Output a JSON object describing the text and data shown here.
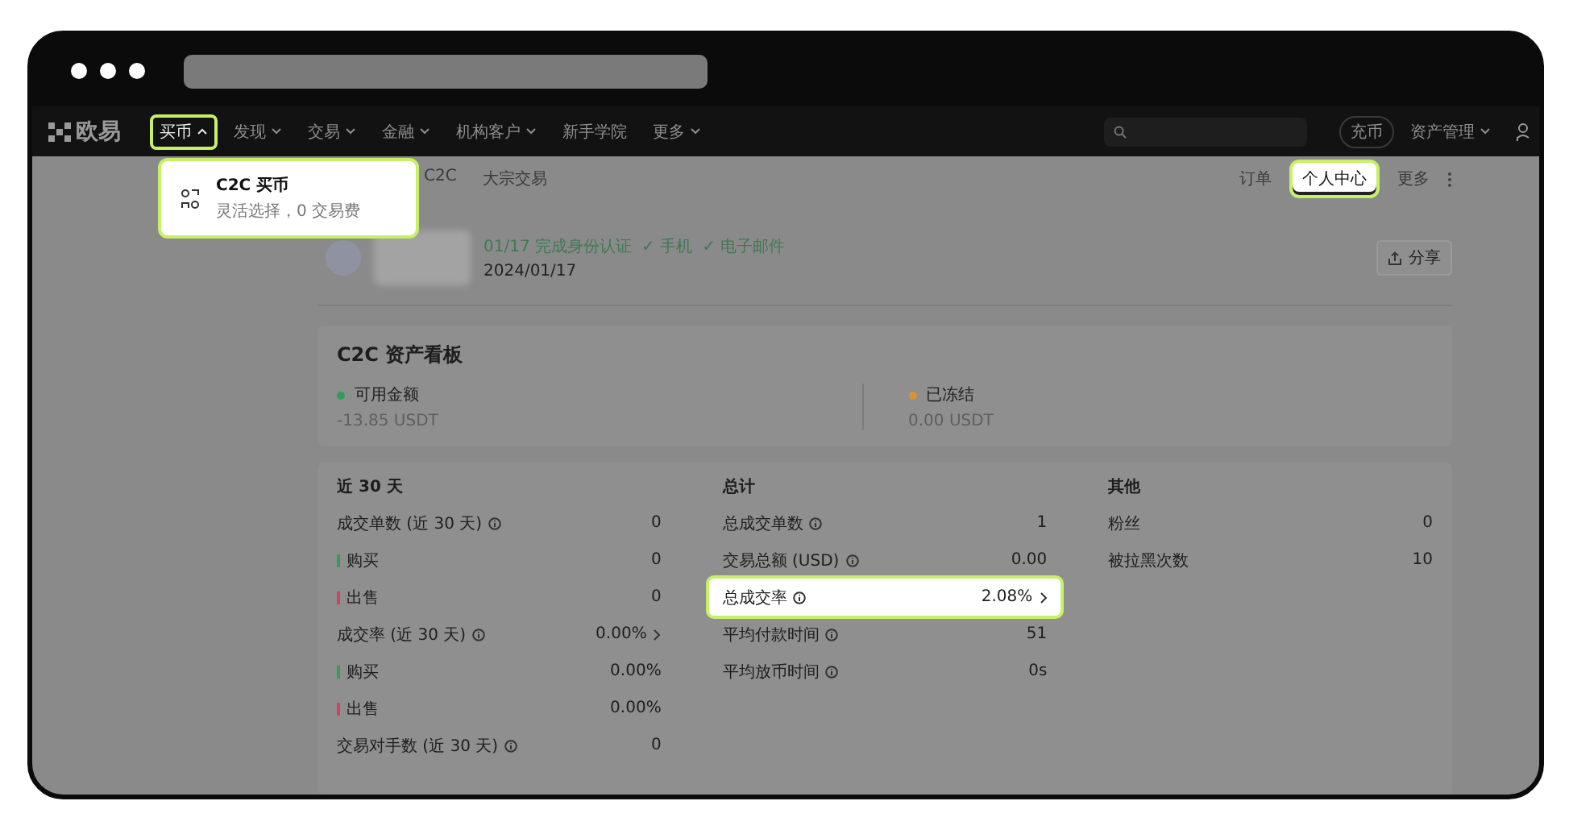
{
  "nav": {
    "logo": "欧易",
    "items": [
      {
        "label": "买币",
        "dropdown": true,
        "highlighted": true
      },
      {
        "label": "发现",
        "dropdown": true,
        "highlighted": false
      },
      {
        "label": "交易",
        "dropdown": true,
        "highlighted": false
      },
      {
        "label": "金融",
        "dropdown": true,
        "highlighted": false
      },
      {
        "label": "机构客户",
        "dropdown": true,
        "highlighted": false
      },
      {
        "label": "新手学院",
        "dropdown": false,
        "highlighted": false
      },
      {
        "label": "更多",
        "dropdown": true,
        "highlighted": false
      }
    ],
    "deposit_button": "充币",
    "asset_menu": "资产管理"
  },
  "dropdown_menu": {
    "items": [
      {
        "title": "C2C 买币",
        "subtitle": "灵活选择，0 交易费"
      }
    ]
  },
  "subnav": {
    "items": [
      "C2C",
      "大宗交易"
    ],
    "tabs": [
      {
        "label": "订单",
        "selected": false,
        "highlighted": false
      },
      {
        "label": "个人中心",
        "selected": true,
        "highlighted": true
      }
    ],
    "more": "更多"
  },
  "profile": {
    "verification": "01/17 完成身份认证",
    "checks": [
      "✓ 手机",
      "✓ 电子邮件"
    ],
    "date": "2024/01/17",
    "share": "分享"
  },
  "assets": {
    "title": "C2C 资产看板",
    "items": [
      {
        "label": "可用金额",
        "value": "-13.85 USDT",
        "color": "#2e9e5b"
      },
      {
        "label": "已冻结",
        "value": "0.00 USDT",
        "color": "#d9952b"
      }
    ]
  },
  "stats": [
    {
      "title": "近 30 天",
      "rows": [
        {
          "label": "成交单数 (近 30 天)",
          "value": "0",
          "kind": "normal",
          "info": true,
          "arrow": false,
          "highlighted": false
        },
        {
          "label": "购买",
          "value": "0",
          "kind": "buy",
          "info": false,
          "arrow": false,
          "highlighted": false
        },
        {
          "label": "出售",
          "value": "0",
          "kind": "sell",
          "info": false,
          "arrow": false,
          "highlighted": false
        },
        {
          "label": "成交率 (近 30 天)",
          "value": "0.00%",
          "kind": "normal",
          "info": true,
          "arrow": true,
          "highlighted": false
        },
        {
          "label": "购买",
          "value": "0.00%",
          "kind": "buy",
          "info": false,
          "arrow": false,
          "highlighted": false
        },
        {
          "label": "出售",
          "value": "0.00%",
          "kind": "sell",
          "info": false,
          "arrow": false,
          "highlighted": false
        },
        {
          "label": "交易对手数 (近 30 天)",
          "value": "0",
          "kind": "normal",
          "info": true,
          "arrow": false,
          "highlighted": false
        }
      ]
    },
    {
      "title": "总计",
      "rows": [
        {
          "label": "总成交单数",
          "value": "1",
          "kind": "normal",
          "info": true,
          "arrow": false,
          "highlighted": false
        },
        {
          "label": "交易总额 (USD)",
          "value": "0.00",
          "kind": "normal",
          "info": true,
          "arrow": false,
          "highlighted": false
        },
        {
          "label": "总成交率",
          "value": "2.08%",
          "kind": "normal",
          "info": true,
          "arrow": true,
          "highlighted": true
        },
        {
          "label": "平均付款时间",
          "value": "51",
          "kind": "normal",
          "info": true,
          "arrow": false,
          "highlighted": false
        },
        {
          "label": "平均放币时间",
          "value": "0s",
          "kind": "normal",
          "info": true,
          "arrow": false,
          "highlighted": false
        }
      ]
    },
    {
      "title": "其他",
      "rows": [
        {
          "label": "粉丝",
          "value": "0",
          "kind": "normal",
          "info": false,
          "arrow": false,
          "highlighted": false
        },
        {
          "label": "被拉黑次数",
          "value": "10",
          "kind": "normal",
          "info": false,
          "arrow": false,
          "highlighted": false
        }
      ]
    }
  ]
}
